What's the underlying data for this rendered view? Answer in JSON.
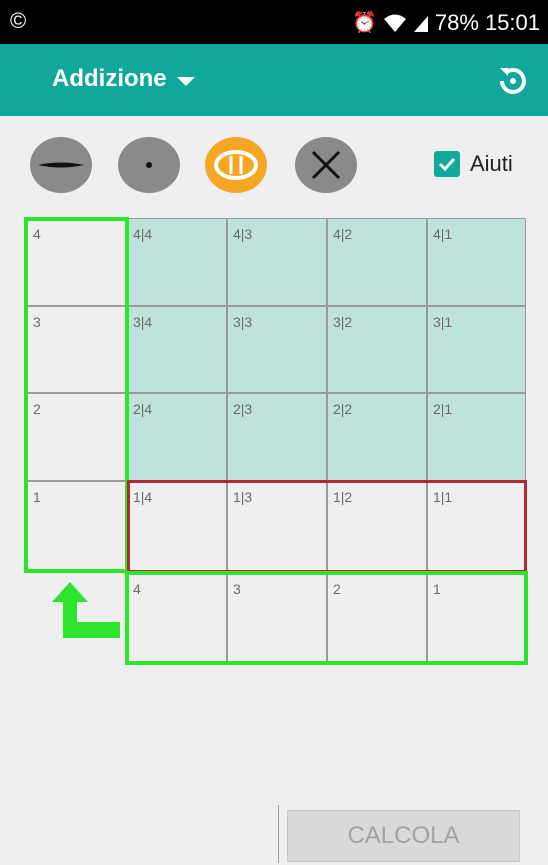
{
  "status_bar": {
    "left_icon": "copyright-icon",
    "battery": "78%",
    "time": "15:01",
    "icons": [
      "alarm-icon",
      "wifi-icon",
      "signal-icon"
    ]
  },
  "toolbar": {
    "title": "Addizione",
    "dropdown_icon": "caret-down-icon",
    "action_icon": "refresh-icon",
    "color": "#10a89a"
  },
  "modes": [
    {
      "name": "line-mode-icon",
      "active": false
    },
    {
      "name": "dot-mode-icon",
      "active": false
    },
    {
      "name": "oval-mode-icon",
      "active": true
    },
    {
      "name": "cross-mode-icon",
      "active": false
    }
  ],
  "hints": {
    "label": "Aiuti",
    "checked": true
  },
  "grid": {
    "row_labels": [
      "4",
      "3",
      "2",
      "1"
    ],
    "cells": [
      [
        "4|4",
        "4|3",
        "4|2",
        "4|1"
      ],
      [
        "3|4",
        "3|3",
        "3|2",
        "3|1"
      ],
      [
        "2|4",
        "2|3",
        "2|2",
        "2|1"
      ],
      [
        "1|4",
        "1|3",
        "1|2",
        "1|1"
      ]
    ],
    "column_labels": [
      "4",
      "3",
      "2",
      "1"
    ],
    "highlight_colors": {
      "green": "#2ee52e",
      "red": "#b02a30",
      "teal": "#c0e2dd"
    }
  },
  "calc_button": {
    "label": "CALCOLA"
  }
}
